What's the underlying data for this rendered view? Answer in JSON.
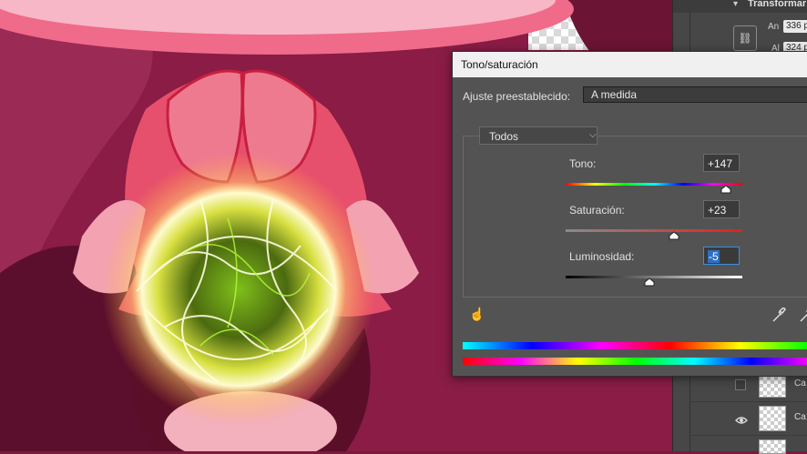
{
  "dialog": {
    "title": "Tono/saturación",
    "preset_label": "Ajuste preestablecido:",
    "preset_value": "A medida",
    "channel": "Todos",
    "sliders": [
      {
        "label": "Tono:",
        "value": "+147",
        "level": 147,
        "min": -180,
        "max": 180
      },
      {
        "label": "Saturación:",
        "value": "+23",
        "level": 23,
        "min": -100,
        "max": 100
      },
      {
        "label": "Luminosidad:",
        "value": "-5",
        "level": -5,
        "min": -100,
        "max": 100
      }
    ],
    "icons": [
      "hand-pointer-icon",
      "eyedropper-icon",
      "eyedropper-plus-icon"
    ]
  },
  "properties": {
    "title": "Transformar",
    "width_label": "An",
    "width_value": "336 p",
    "height_label": "Al",
    "height_value": "324 p"
  },
  "layers": [
    {
      "name": "Ca",
      "visible": false
    },
    {
      "name": "Ca",
      "visible": true
    }
  ],
  "colors": {
    "dialog_bg": "#535353",
    "panel_bg": "#474747",
    "canvas_bg": "#7a1a3c",
    "focus_blue": "#3c8fe0"
  }
}
